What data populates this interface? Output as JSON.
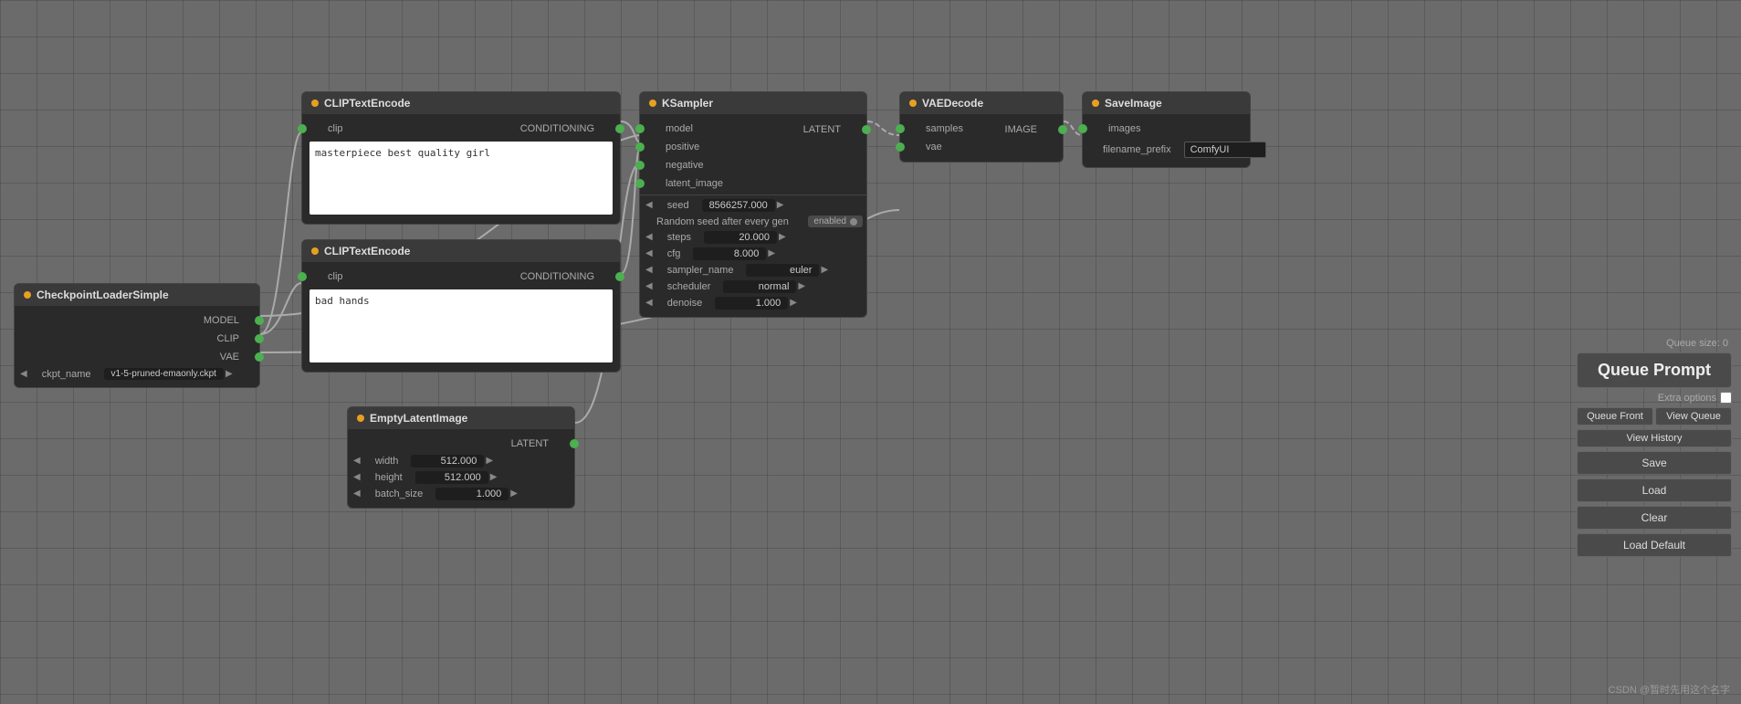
{
  "nodes": {
    "checkpoint": {
      "title": "CheckpointLoaderSimple",
      "outputs": [
        "MODEL",
        "CLIP",
        "VAE"
      ],
      "params": [
        {
          "name": "ckpt_name",
          "value": "v1-5-pruned-emaonly.ckpt"
        }
      ]
    },
    "clip1": {
      "title": "CLIPTextEncode",
      "inputs": [
        "clip"
      ],
      "outputs": [
        "CONDITIONING"
      ],
      "text": "masterpiece best quality girl"
    },
    "clip2": {
      "title": "CLIPTextEncode",
      "inputs": [
        "clip"
      ],
      "outputs": [
        "CONDITIONING"
      ],
      "text": "bad hands"
    },
    "latent": {
      "title": "EmptyLatentImage",
      "outputs": [
        "LATENT"
      ],
      "params": [
        {
          "name": "width",
          "value": "512.000"
        },
        {
          "name": "height",
          "value": "512.000"
        },
        {
          "name": "batch_size",
          "value": "1.000"
        }
      ]
    },
    "ksampler": {
      "title": "KSampler",
      "inputs": [
        "model",
        "positive",
        "negative",
        "latent_image"
      ],
      "outputs": [
        "LATENT"
      ],
      "params": [
        {
          "name": "seed",
          "value": "8566257.000"
        },
        {
          "name": "Random seed after every gen",
          "value": "enabled"
        },
        {
          "name": "steps",
          "value": "20.000"
        },
        {
          "name": "cfg",
          "value": "8.000"
        },
        {
          "name": "sampler_name",
          "value": "euler"
        },
        {
          "name": "scheduler",
          "value": "normal"
        },
        {
          "name": "denoise",
          "value": "1.000"
        }
      ]
    },
    "vaedecode": {
      "title": "VAEDecode",
      "inputs": [
        "samples",
        "vae"
      ],
      "outputs": [
        "IMAGE"
      ]
    },
    "saveimage": {
      "title": "SaveImage",
      "inputs": [
        "images"
      ],
      "params": [
        {
          "name": "filename_prefix",
          "value": "ComfyUI"
        }
      ]
    }
  },
  "panel": {
    "queue_size_label": "Queue size: 0",
    "queue_prompt_label": "Queue Prompt",
    "extra_options_label": "Extra options",
    "queue_front_label": "Queue Front",
    "view_queue_label": "View Queue",
    "view_history_label": "View History",
    "save_label": "Save",
    "load_label": "Load",
    "clear_label": "Clear",
    "load_default_label": "Load Default"
  },
  "watermark": "CSDN @暂时先用这个名字"
}
